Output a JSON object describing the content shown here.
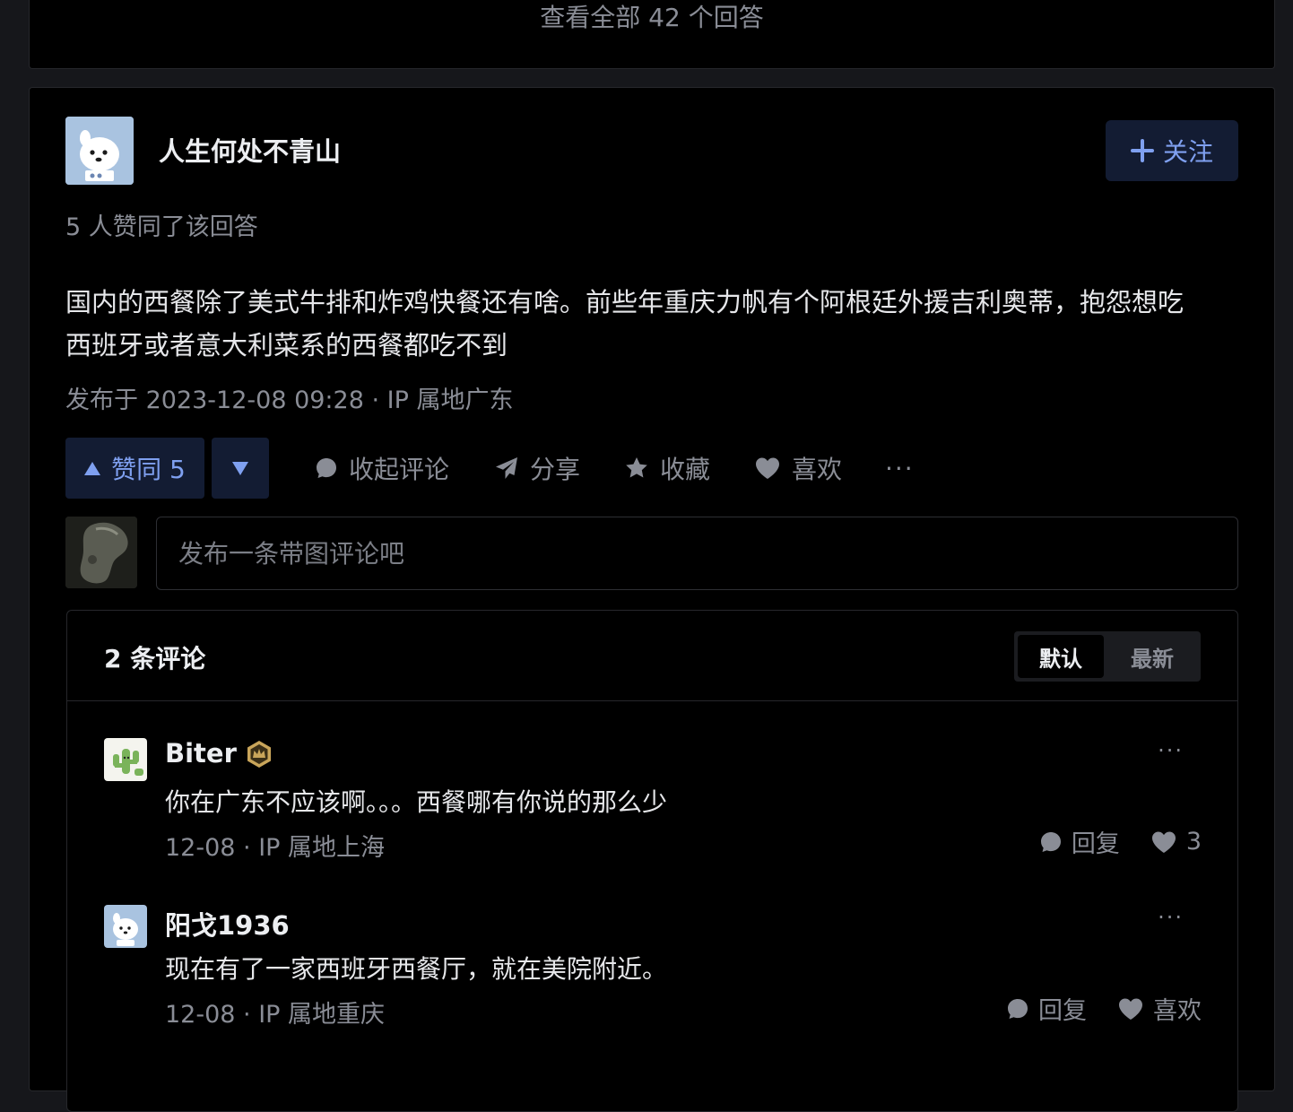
{
  "top_card": {
    "view_all": "查看全部 42 个回答"
  },
  "answer": {
    "author": {
      "name": "人生何处不青山"
    },
    "follow_label": "关注",
    "votes_summary": "5 人赞同了该回答",
    "content_line1": "国内的西餐除了美式牛排和炸鸡快餐还有啥。前些年重庆力帆有个阿根廷外援吉利奥蒂，抱怨想吃",
    "content_line2": "西班牙或者意大利菜系的西餐都吃不到",
    "meta": "发布于 2023-12-08 09:28 · IP 属地广东",
    "actions": {
      "upvote": "赞同 5",
      "collapse_comments": "收起评论",
      "share": "分享",
      "favorite": "收藏",
      "like": "喜欢",
      "more": "···"
    }
  },
  "comment_input": {
    "placeholder": "发布一条带图评论吧"
  },
  "comments": {
    "count_label": "2 条评论",
    "sort": {
      "default": "默认",
      "latest": "最新"
    },
    "items": [
      {
        "name": "Biter",
        "text": "你在广东不应该啊。。。西餐哪有你说的那么少",
        "meta": "12-08  ·  IP 属地上海",
        "reply": "回复",
        "like": "3",
        "more": "···"
      },
      {
        "name": "阳戈1936",
        "text": "现在有了一家西班牙西餐厅，就在美院附近。",
        "meta": "12-08  ·  IP 属地重庆",
        "reply": "回复",
        "like": "喜欢",
        "more": "···"
      }
    ]
  },
  "colors": {
    "background": "#000000",
    "page_bg": "#16171b",
    "accent": "#7fa0f0",
    "accent_bg": "#131c33",
    "muted": "#8a8d96",
    "badge_gold": "#c9a55a"
  }
}
